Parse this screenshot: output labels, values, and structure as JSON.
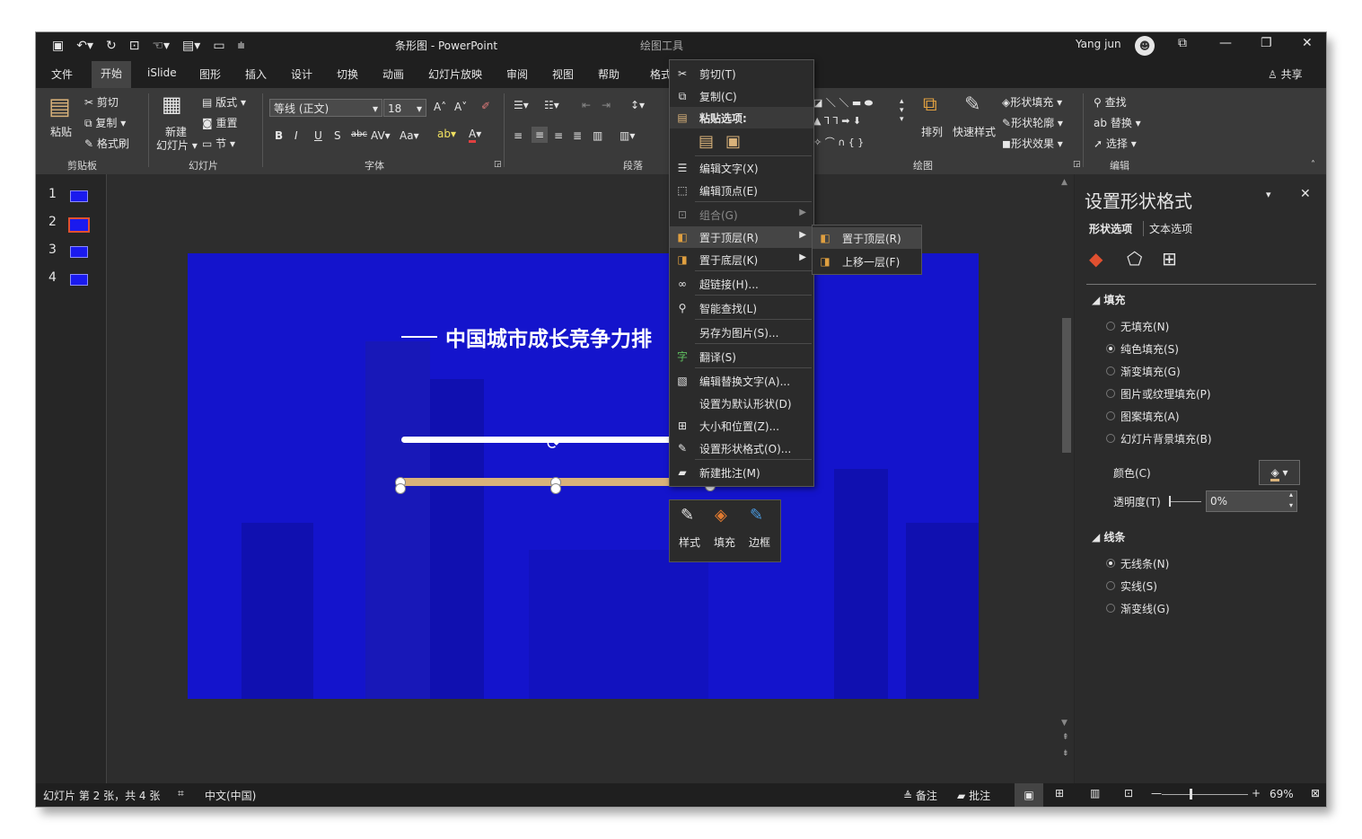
{
  "titlebar": {
    "doc_title": "条形图  -  PowerPoint",
    "context_tool": "绘图工具",
    "user": "Yang jun",
    "qat_icons": [
      "save-icon",
      "undo-icon",
      "redo-icon",
      "slideshow-icon",
      "customize-icon"
    ]
  },
  "tabs": [
    "文件",
    "开始",
    "iSlide",
    "图形",
    "插入",
    "设计",
    "切换",
    "动画",
    "幻灯片放映",
    "审阅",
    "视图",
    "帮助",
    "格式"
  ],
  "share_label": "共享",
  "ribbon": {
    "paste": "粘贴",
    "cut": "剪切",
    "copy": "复制",
    "format_painter": "格式刷",
    "new_slide_1": "新建",
    "new_slide_2": "幻灯片",
    "layout": "版式",
    "reset": "重置",
    "section": "节",
    "font_name": "等线 (正文)",
    "font_size": "18",
    "arrange": "排列",
    "quick_styles": "快速样式",
    "shape_fill": "形状填充",
    "shape_outline": "形状轮廓",
    "shape_effects": "形状效果",
    "find": "查找",
    "replace": "替换",
    "select": "选择",
    "groups": {
      "clipboard": "剪贴板",
      "slides": "幻灯片",
      "font": "字体",
      "paragraph": "段落",
      "drawing": "绘图",
      "editing": "编辑"
    }
  },
  "thumbnails": [
    "1",
    "2",
    "3",
    "4"
  ],
  "slide": {
    "title": "中国城市成长竞争力排"
  },
  "context_menu": {
    "items": [
      {
        "label": "剪切(T)",
        "icon": "scissors-icon"
      },
      {
        "label": "复制(C)",
        "icon": "copy-icon"
      },
      {
        "label": "粘贴选项:",
        "icon": "paste-icon"
      },
      {
        "label": "编辑文字(X)",
        "icon": "edit-text-icon"
      },
      {
        "label": "编辑顶点(E)",
        "icon": "edit-points-icon"
      },
      {
        "label": "组合(G)",
        "icon": "group-icon"
      },
      {
        "label": "置于顶层(R)",
        "icon": "bring-front-icon"
      },
      {
        "label": "置于底层(K)",
        "icon": "send-back-icon"
      },
      {
        "label": "超链接(H)...",
        "icon": "link-icon"
      },
      {
        "label": "智能查找(L)",
        "icon": "smart-lookup-icon"
      },
      {
        "label": "另存为图片(S)...",
        "icon": ""
      },
      {
        "label": "翻译(S)",
        "icon": "translate-icon"
      },
      {
        "label": "编辑替换文字(A)...",
        "icon": "alt-text-icon"
      },
      {
        "label": "设置为默认形状(D)",
        "icon": ""
      },
      {
        "label": "大小和位置(Z)...",
        "icon": "size-position-icon"
      },
      {
        "label": "设置形状格式(O)...",
        "icon": "format-shape-icon"
      },
      {
        "label": "新建批注(M)",
        "icon": "comment-icon"
      }
    ],
    "submenu": [
      {
        "label": "置于顶层(R)",
        "icon": "bring-front-icon"
      },
      {
        "label": "上移一层(F)",
        "icon": "bring-forward-icon"
      }
    ]
  },
  "mini_toolbar": [
    "样式",
    "填充",
    "边框"
  ],
  "format_pane": {
    "title": "设置形状格式",
    "tab_shape": "形状选项",
    "tab_text": "文本选项",
    "fill_section": "填充",
    "fill_options": [
      "无填充(N)",
      "纯色填充(S)",
      "渐变填充(G)",
      "图片或纹理填充(P)",
      "图案填充(A)",
      "幻灯片背景填充(B)"
    ],
    "fill_selected": 1,
    "color_label": "颜色(C)",
    "transparency_label": "透明度(T)",
    "transparency_value": "0%",
    "line_section": "线条",
    "line_options": [
      "无线条(N)",
      "实线(S)",
      "渐变线(G)"
    ],
    "line_selected": 0
  },
  "statusbar": {
    "slide_info": "幻灯片 第 2 张，共 4 张",
    "language": "中文(中国)",
    "notes": "备注",
    "comments": "批注",
    "zoom": "69%"
  },
  "colors": {
    "slide_blue": "#1414cc",
    "shape_tan": "#d9b27a",
    "thumb_selected": "#e05030"
  }
}
